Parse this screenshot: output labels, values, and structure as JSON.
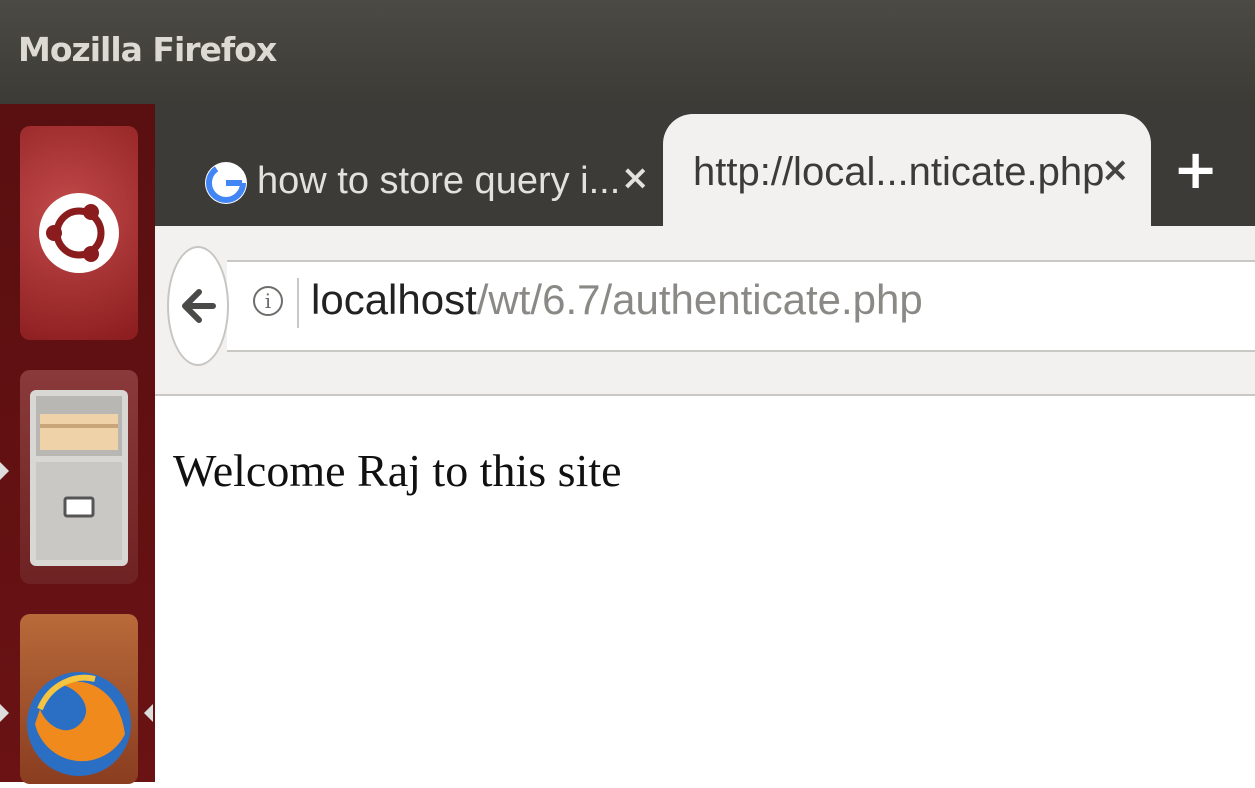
{
  "window": {
    "title": "Mozilla Firefox"
  },
  "tabs": [
    {
      "label": "how to store query i...",
      "icon": "google-icon",
      "active": false
    },
    {
      "label": "http://local...nticate.php",
      "icon": null,
      "active": true
    }
  ],
  "tab_close_glyph": "×",
  "new_tab_glyph": "+",
  "urlbar": {
    "host": "localhost",
    "path": "/wt/6.7/authenticate.php"
  },
  "page": {
    "message": "Welcome Raj to this site"
  },
  "launcher": {
    "items": [
      {
        "name": "ubuntu-dash",
        "icon": "ubuntu-logo-icon"
      },
      {
        "name": "files",
        "icon": "file-cabinet-icon"
      },
      {
        "name": "firefox",
        "icon": "firefox-icon"
      }
    ]
  },
  "colors": {
    "titlebar": "#3c3b36",
    "tabstrip": "#3c3b37",
    "active_tab": "#f2f1f0",
    "launcher": "#5a0f10",
    "url_path": "#8a8986"
  }
}
